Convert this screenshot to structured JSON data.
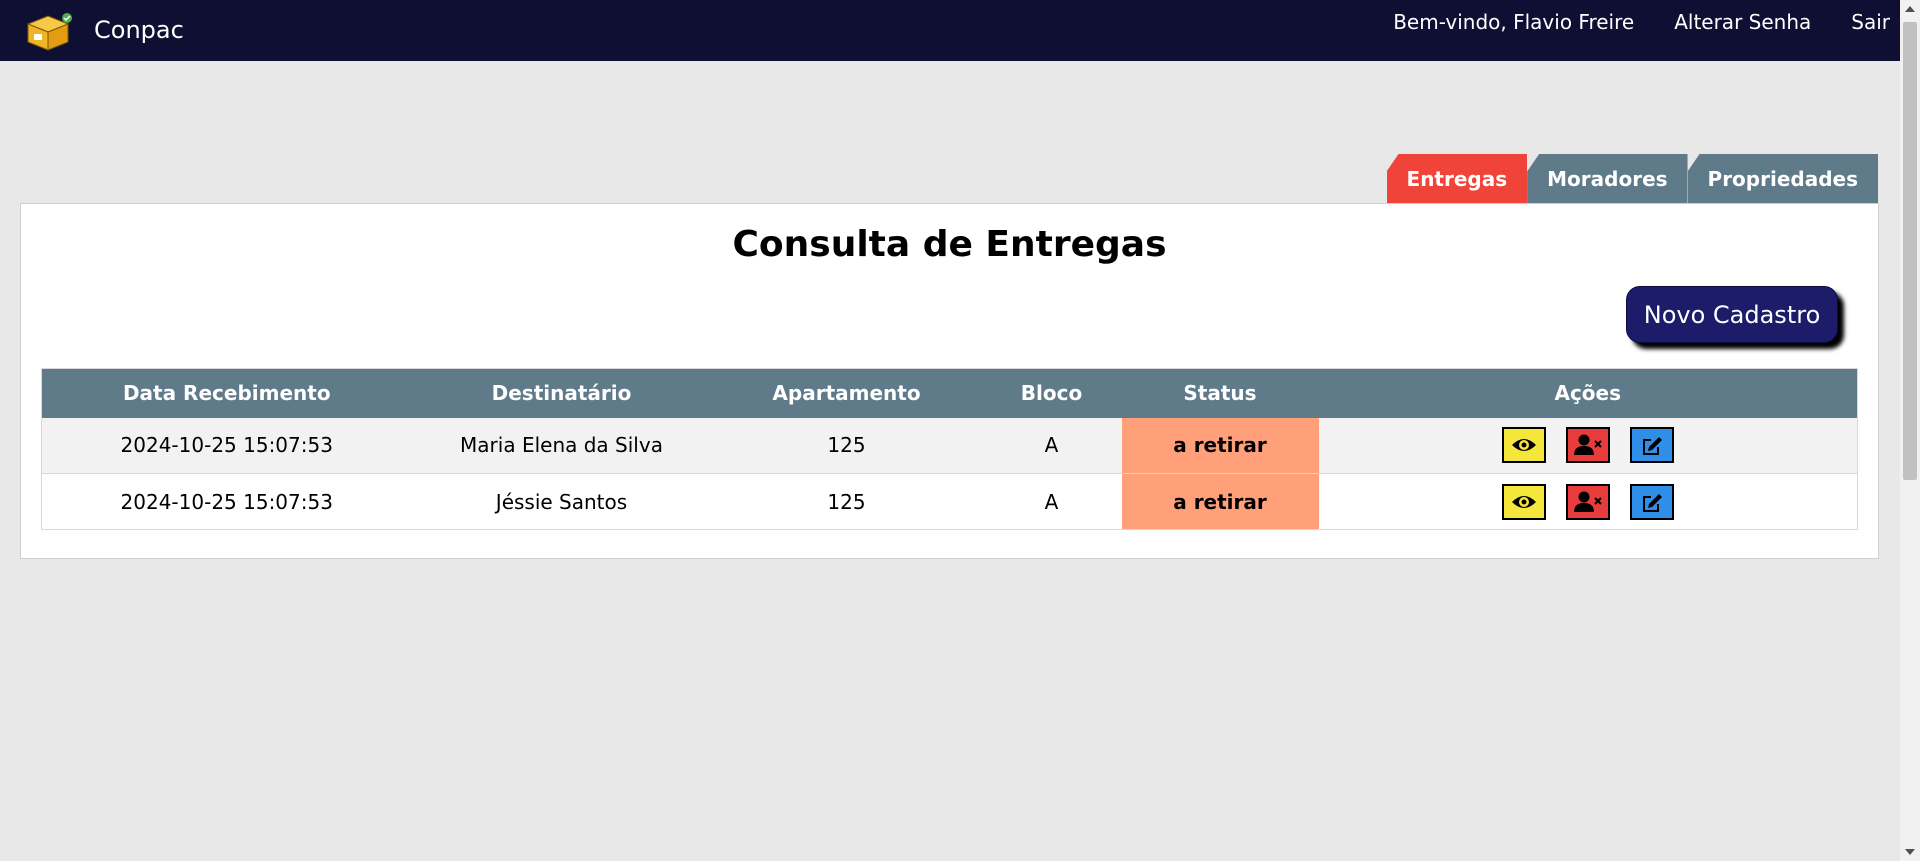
{
  "header": {
    "app_name": "Conpac",
    "welcome": "Bem-vindo, Flavio Freire",
    "change_password": "Alterar Senha",
    "logout": "Sair"
  },
  "tabs": [
    {
      "label": "Entregas",
      "active": true
    },
    {
      "label": "Moradores",
      "active": false
    },
    {
      "label": "Propriedades",
      "active": false
    }
  ],
  "main": {
    "title": "Consulta de Entregas",
    "new_button": "Novo Cadastro"
  },
  "table": {
    "columns": [
      "Data Recebimento",
      "Destinatário",
      "Apartamento",
      "Bloco",
      "Status",
      "Ações"
    ],
    "rows": [
      {
        "date": "2024-10-25 15:07:53",
        "recipient": "Maria Elena da Silva",
        "apartment": "125",
        "block": "A",
        "status": "a retirar"
      },
      {
        "date": "2024-10-25 15:07:53",
        "recipient": "Jéssie Santos",
        "apartment": "125",
        "block": "A",
        "status": "a retirar"
      }
    ]
  },
  "colors": {
    "topbar": "#0f0f33",
    "tab_active": "#f0443a",
    "tab_inactive": "#5f7b8a",
    "status_bg": "#ffa07a",
    "view_btn": "#f5e63c",
    "delete_btn": "#e83c3c",
    "edit_btn": "#2f8fe8"
  },
  "icons": {
    "logo": "package-box-icon",
    "view": "eye-icon",
    "delete": "user-remove-icon",
    "edit": "edit-icon"
  }
}
